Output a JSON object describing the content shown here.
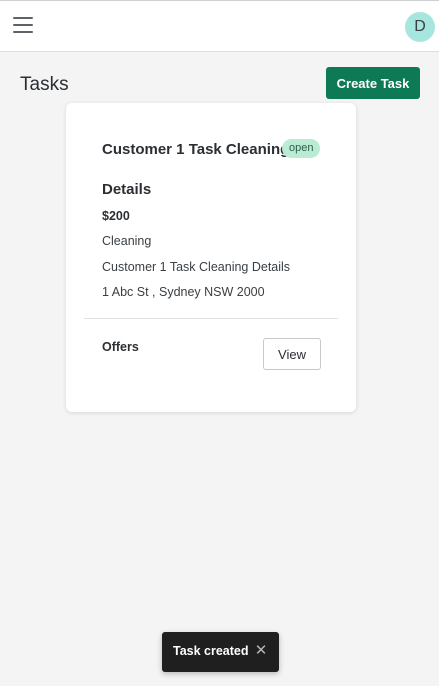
{
  "header": {
    "menu_icon": "hamburger-menu-icon",
    "avatar_initial": "D",
    "avatar_color": "#a6e6df"
  },
  "page": {
    "title": "Tasks",
    "create_button_label": "Create Task",
    "accent_color": "#0e7a55"
  },
  "task_card": {
    "title": "Customer 1 Task Cleaning",
    "status": "open",
    "status_color": "#b9ecd3",
    "details_heading": "Details",
    "price": "$200",
    "category": "Cleaning",
    "description": "Customer 1 Task Cleaning Details",
    "address": "1 Abc St , Sydney NSW 2000",
    "offers_label": "Offers",
    "view_button_label": "View"
  },
  "toast": {
    "message": "Task created",
    "close_icon": "close-icon",
    "close_glyph": "✕"
  }
}
